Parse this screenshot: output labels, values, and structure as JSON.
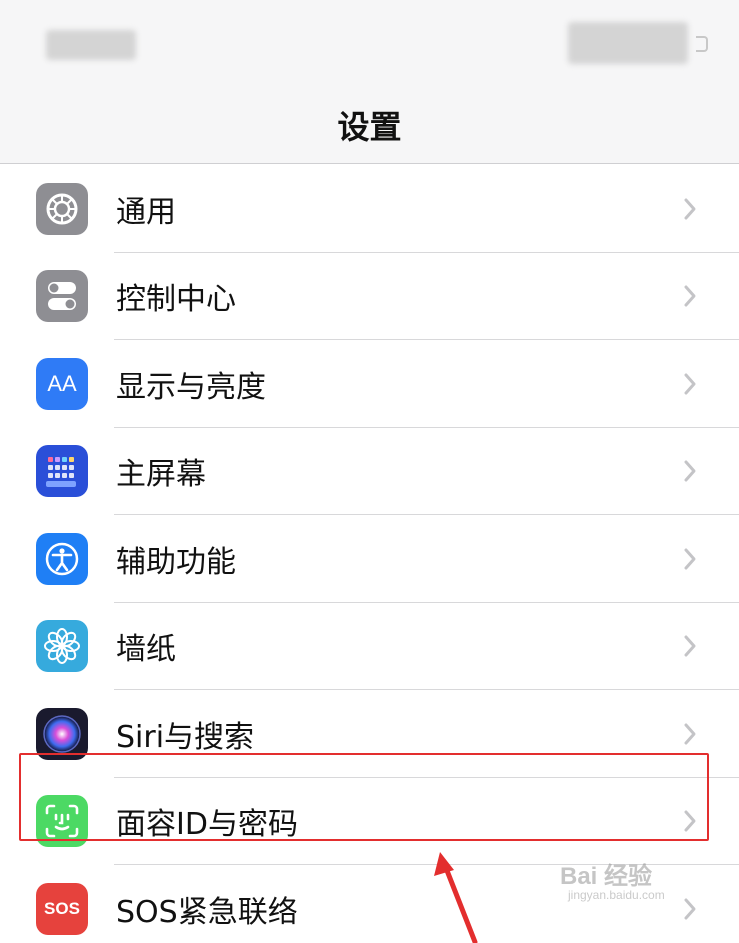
{
  "nav": {
    "title": "设置"
  },
  "settings": [
    {
      "label": "通用",
      "icon": "gear-icon",
      "color": "#8e8e93"
    },
    {
      "label": "控制中心",
      "icon": "toggles-icon",
      "color": "#8e8e93"
    },
    {
      "label": "显示与亮度",
      "icon": "text-size-icon",
      "icon_text": "AA",
      "color": "#2f7bf6"
    },
    {
      "label": "主屏幕",
      "icon": "home-screen-grid-icon",
      "color": "#2a4fd8"
    },
    {
      "label": "辅助功能",
      "icon": "accessibility-icon",
      "color": "#1f7ff5"
    },
    {
      "label": "墙纸",
      "icon": "flower-icon",
      "color": "#36aadd"
    },
    {
      "label": "Siri与搜索",
      "icon": "siri-icon",
      "color": "#1a1a2e"
    },
    {
      "label": "面容ID与密码",
      "icon": "face-id-icon",
      "color": "#4cd964",
      "highlighted": true
    },
    {
      "label": "SOS紧急联络",
      "icon": "sos-icon",
      "icon_text": "SOS",
      "color": "#e6423d"
    }
  ],
  "watermark": {
    "text": "Bai 经验",
    "sub": "jingyan.baidu.com"
  },
  "annotation": {
    "highlight_color": "#e32e2e"
  }
}
